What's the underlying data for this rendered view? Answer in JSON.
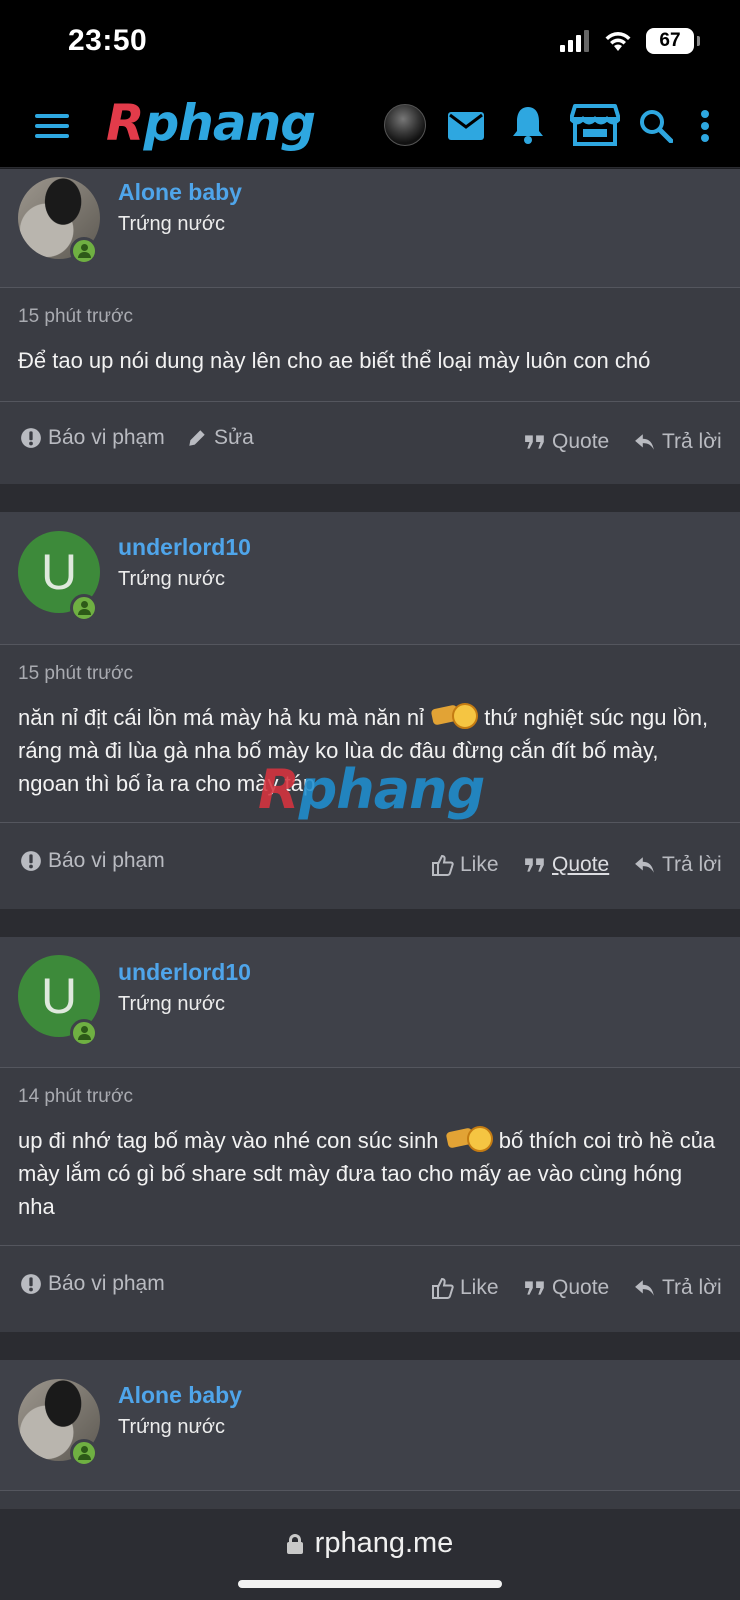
{
  "status_bar": {
    "time": "23:50",
    "battery": "67"
  },
  "header": {
    "logo_first": "R",
    "logo_rest": "phang"
  },
  "posts": [
    {
      "username": "Alone baby",
      "user_title": "Trứng nước",
      "avatar_type": "photo",
      "time": "15 phút trước",
      "text": "Để tao up nói dung này lên cho ae biết thể loại mày luôn con chó",
      "actions": {
        "report": "Báo vi phạm",
        "edit": "Sửa",
        "quote": "Quote",
        "reply": "Trả lời"
      }
    },
    {
      "username": "underlord10",
      "user_title": "Trứng nước",
      "avatar_letter": "U",
      "time": "15 phút trước",
      "text_before": "năn nỉ địt cái lồn má mày hả ku mà năn nỉ ",
      "text_after": " thứ nghiệt súc ngu lồn, ráng mà đi lùa gà nha bố mày ko lùa dc đâu đừng cắn đít bố mày, ngoan thì bố ỉa ra cho mày táp",
      "actions": {
        "report": "Báo vi phạm",
        "like": "Like",
        "quote": "Quote",
        "reply": "Trả lời"
      }
    },
    {
      "username": "underlord10",
      "user_title": "Trứng nước",
      "avatar_letter": "U",
      "time": "14 phút trước",
      "text_before": "up đi nhớ tag bố mày vào nhé con súc sinh ",
      "text_after": " bố thích coi trò hề của mày lắm có gì bố share sdt mày đưa tao cho mấy ae vào cùng hóng nha",
      "actions": {
        "report": "Báo vi phạm",
        "like": "Like",
        "quote": "Quote",
        "reply": "Trả lời"
      }
    },
    {
      "username": "Alone baby",
      "user_title": "Trứng nước",
      "avatar_type": "photo"
    }
  ],
  "watermark": {
    "first": "R",
    "rest": "phang"
  },
  "url_bar": {
    "domain": "rphang.me"
  },
  "colors": {
    "accent": "#4fa5ea",
    "header_icons": "#2ea7e0",
    "online": "#6fb042"
  }
}
